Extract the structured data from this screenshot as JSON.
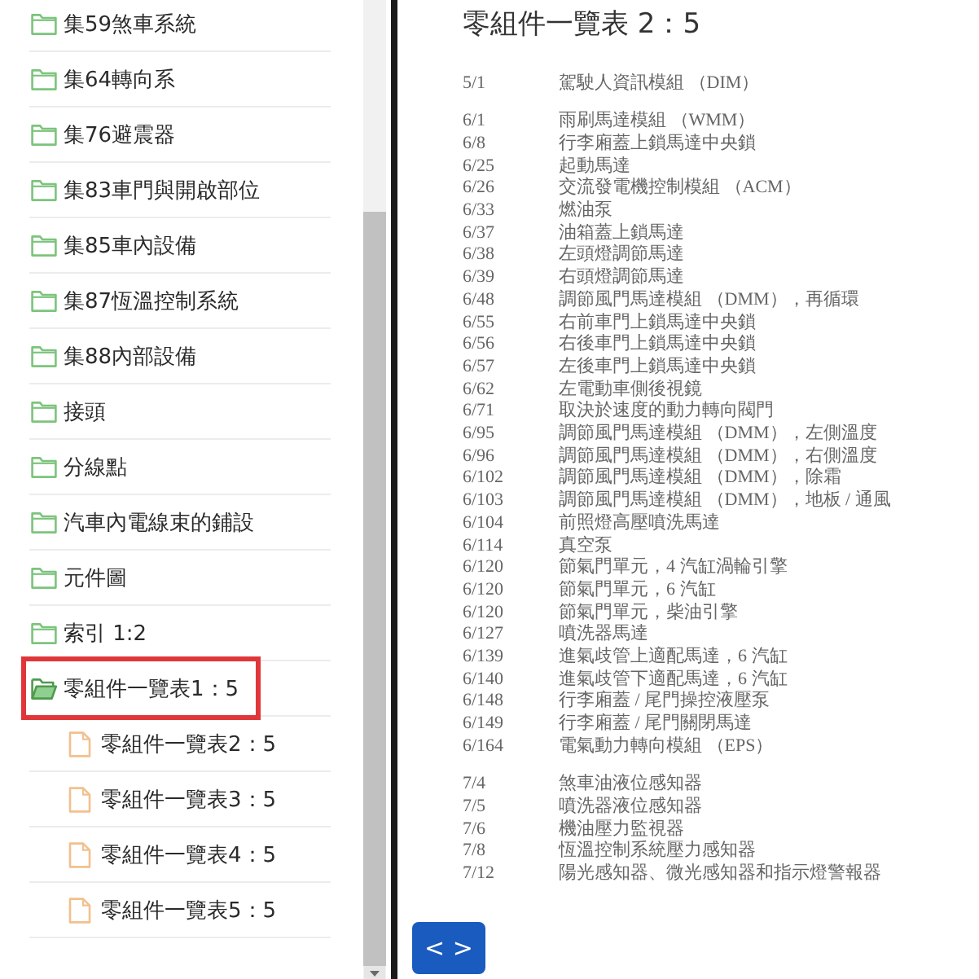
{
  "sidebar": {
    "items": [
      {
        "label": "集59煞車系統",
        "kind": "folder",
        "expanded": false,
        "selected": false
      },
      {
        "label": "集64轉向系",
        "kind": "folder",
        "expanded": false,
        "selected": false
      },
      {
        "label": "集76避震器",
        "kind": "folder",
        "expanded": false,
        "selected": false
      },
      {
        "label": "集83車門與開啟部位",
        "kind": "folder",
        "expanded": false,
        "selected": false
      },
      {
        "label": "集85車內設備",
        "kind": "folder",
        "expanded": false,
        "selected": false
      },
      {
        "label": "集87恆溫控制系統",
        "kind": "folder",
        "expanded": false,
        "selected": false
      },
      {
        "label": "集88內部設備",
        "kind": "folder",
        "expanded": false,
        "selected": false
      },
      {
        "label": "接頭",
        "kind": "folder",
        "expanded": false,
        "selected": false
      },
      {
        "label": "分線點",
        "kind": "folder",
        "expanded": false,
        "selected": false
      },
      {
        "label": "汽車內電線束的鋪設",
        "kind": "folder",
        "expanded": false,
        "selected": false
      },
      {
        "label": "元件圖",
        "kind": "folder",
        "expanded": false,
        "selected": false
      },
      {
        "label": "索引 1:2",
        "kind": "folder",
        "expanded": false,
        "selected": false
      },
      {
        "label": "零組件一覽表1：5",
        "kind": "folder",
        "expanded": true,
        "selected": true,
        "children": [
          {
            "label": "零組件一覽表2：5",
            "kind": "file",
            "selected": false
          },
          {
            "label": "零組件一覽表3：5",
            "kind": "file",
            "selected": false
          },
          {
            "label": "零組件一覽表4：5",
            "kind": "file",
            "selected": false
          },
          {
            "label": "零組件一覽表5：5",
            "kind": "file",
            "selected": false
          }
        ]
      }
    ]
  },
  "document": {
    "title": "零組件一覽表 2：5",
    "groups": [
      {
        "entries": [
          {
            "code": "5/1",
            "name": "駕駛人資訊模組 （DIM）"
          }
        ]
      },
      {
        "entries": [
          {
            "code": "6/1",
            "name": "雨刷馬達模組 （WMM）"
          },
          {
            "code": "6/8",
            "name": "行李廂蓋上鎖馬達中央鎖"
          },
          {
            "code": "6/25",
            "name": "起動馬達"
          },
          {
            "code": "6/26",
            "name": "交流發電機控制模組 （ACM）"
          },
          {
            "code": "6/33",
            "name": "燃油泵"
          },
          {
            "code": "6/37",
            "name": "油箱蓋上鎖馬達"
          },
          {
            "code": "6/38",
            "name": "左頭燈調節馬達"
          },
          {
            "code": "6/39",
            "name": "右頭燈調節馬達"
          },
          {
            "code": "6/48",
            "name": "調節風門馬達模組 （DMM），再循環"
          },
          {
            "code": "6/55",
            "name": "右前車門上鎖馬達中央鎖"
          },
          {
            "code": "6/56",
            "name": "右後車門上鎖馬達中央鎖"
          },
          {
            "code": "6/57",
            "name": "左後車門上鎖馬達中央鎖"
          },
          {
            "code": "6/62",
            "name": "左電動車側後視鏡"
          },
          {
            "code": "6/71",
            "name": "取決於速度的動力轉向閥門"
          },
          {
            "code": "6/95",
            "name": "調節風門馬達模組 （DMM），左側溫度"
          },
          {
            "code": "6/96",
            "name": "調節風門馬達模組 （DMM），右側溫度"
          },
          {
            "code": "6/102",
            "name": "調節風門馬達模組 （DMM），除霜"
          },
          {
            "code": "6/103",
            "name": "調節風門馬達模組 （DMM），地板 / 通風"
          },
          {
            "code": "6/104",
            "name": "前照燈高壓噴洗馬達"
          },
          {
            "code": "6/114",
            "name": "真空泵"
          },
          {
            "code": "6/120",
            "name": "節氣門單元，4 汽缸渦輪引擎"
          },
          {
            "code": "6/120",
            "name": "節氣門單元，6 汽缸"
          },
          {
            "code": "6/120",
            "name": "節氣門單元，柴油引擎"
          },
          {
            "code": "6/127",
            "name": "噴洗器馬達"
          },
          {
            "code": "6/139",
            "name": "進氣歧管上適配馬達，6 汽缸"
          },
          {
            "code": "6/140",
            "name": "進氣歧管下適配馬達，6 汽缸"
          },
          {
            "code": "6/148",
            "name": "行李廂蓋 / 尾門操控液壓泵"
          },
          {
            "code": "6/149",
            "name": "行李廂蓋 / 尾門關閉馬達"
          },
          {
            "code": "6/164",
            "name": "電氣動力轉向模組 （EPS）"
          }
        ]
      },
      {
        "entries": [
          {
            "code": "7/4",
            "name": "煞車油液位感知器"
          },
          {
            "code": "7/5",
            "name": "噴洗器液位感知器"
          },
          {
            "code": "7/6",
            "name": "機油壓力監視器"
          },
          {
            "code": "7/8",
            "name": "恆溫控制系統壓力感知器"
          },
          {
            "code": "7/12",
            "name": "陽光感知器、微光感知器和指示燈警報器"
          }
        ]
      }
    ]
  },
  "nav_button": {
    "label": "< >"
  }
}
